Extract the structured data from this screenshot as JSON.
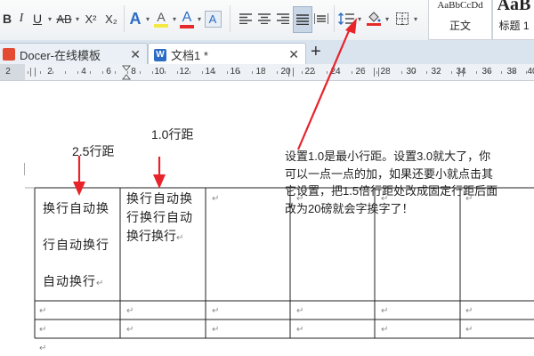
{
  "toolbar": {
    "bold": "B",
    "italic": "I",
    "underline": "U",
    "strike": "AB",
    "superscript": "X²",
    "subscript": "X₂",
    "text_effect": "A",
    "highlight": "A",
    "font_color": "A",
    "clear_format": "A",
    "styles": [
      {
        "preview": "AaBbCcDd",
        "label": "正文"
      },
      {
        "preview": "AaB",
        "label": "标题 1"
      }
    ]
  },
  "tabs": [
    {
      "label": "Docer-在线模板",
      "icon": "docer-icon",
      "active": false
    },
    {
      "label": "文档1 *",
      "icon": "word-doc-icon",
      "active": true
    }
  ],
  "new_tab": "+",
  "ruler": {
    "numbers": [
      "2",
      "2",
      "4",
      "6",
      "8",
      "10",
      "12",
      "14",
      "16",
      "18",
      "20",
      "22",
      "24",
      "26",
      "28",
      "30",
      "32",
      "34",
      "36",
      "38",
      "40"
    ]
  },
  "annotations": {
    "line_2_5": "2.5行距",
    "line_1_0": "1.0行距",
    "note_lines": [
      "设置1.0是最小行距。设置3.0就大了，你",
      "可以一点一点的加，如果还要小就点击其",
      "它设置，把1.5倍行距处改成固定行距后面",
      "改为20磅就会字挨字了！"
    ]
  },
  "table": {
    "cell_a": [
      "换行自动换",
      "行自动换行",
      "自动换行"
    ],
    "cell_b": [
      "换行自动换",
      "行换行自动",
      "换行换行"
    ],
    "para_mark": "↵"
  },
  "colors": {
    "arrow": "#e8232a",
    "accent": "#2b6cc4",
    "font_color_bar": "#e52a2a",
    "highlight_bar": "#f4e842"
  }
}
